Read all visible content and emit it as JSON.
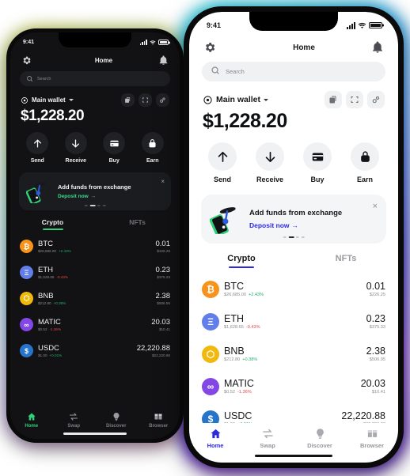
{
  "status_bar": {
    "time": "9:41"
  },
  "header": {
    "title": "Home",
    "settings_icon": "gear-icon",
    "bell_icon": "bell-icon"
  },
  "search": {
    "placeholder": "Search",
    "icon": "search-icon"
  },
  "wallet": {
    "name": "Main wallet",
    "eye_icon": "eye-icon",
    "balance": "$1,228.20",
    "tools": [
      {
        "name": "copy-icon",
        "label": "Copy"
      },
      {
        "name": "scan-icon",
        "label": "Scan"
      },
      {
        "name": "link-icon",
        "label": "Connect"
      }
    ]
  },
  "actions": [
    {
      "label": "Send",
      "icon": "arrow-up-icon"
    },
    {
      "label": "Receive",
      "icon": "arrow-down-icon"
    },
    {
      "label": "Buy",
      "icon": "card-icon"
    },
    {
      "label": "Earn",
      "icon": "lock-icon"
    }
  ],
  "promo": {
    "title": "Add funds from exchange",
    "link": "Deposit now",
    "arrow": "→",
    "close": "×",
    "art_icon": "phone-exchange-illustration"
  },
  "tabs": [
    {
      "label": "Crypto",
      "active": true
    },
    {
      "label": "NFTs",
      "active": false
    }
  ],
  "assets": [
    {
      "symbol": "BTC",
      "price": "$26,685.00",
      "change": "+2.43%",
      "dir": "up",
      "amount": "0.01",
      "fiat": "$226.25",
      "color": "#f7931a",
      "glyph": "₿"
    },
    {
      "symbol": "ETH",
      "price": "$1,628.65",
      "change": "-0.43%",
      "dir": "down",
      "amount": "0.23",
      "fiat": "$375.33",
      "color": "#627eea",
      "glyph": "Ξ"
    },
    {
      "symbol": "BNB",
      "price": "$212.80",
      "change": "+0.38%",
      "dir": "up",
      "amount": "2.38",
      "fiat": "$506.95",
      "color": "#f0b90b",
      "glyph": "⬡"
    },
    {
      "symbol": "MATIC",
      "price": "$0.52",
      "change": "-1.36%",
      "dir": "down",
      "amount": "20.03",
      "fiat": "$10.41",
      "color": "#8247e5",
      "glyph": "∞"
    },
    {
      "symbol": "USDC",
      "price": "$1.00",
      "change": "+0.01%",
      "dir": "up",
      "amount": "22,220.88",
      "fiat": "$22,220.88",
      "color": "#2775ca",
      "glyph": "$"
    }
  ],
  "bottom_nav": [
    {
      "label": "Home",
      "icon": "home-icon",
      "active": true
    },
    {
      "label": "Swap",
      "icon": "swap-icon",
      "active": false
    },
    {
      "label": "Discover",
      "icon": "bulb-icon",
      "active": false
    },
    {
      "label": "Browser",
      "icon": "browser-icon",
      "active": false
    }
  ],
  "theme": {
    "dark_accent": "#2fd07a",
    "light_accent": "#2b2bd9",
    "dark_bg": "#121214",
    "light_bg": "#ffffff"
  }
}
